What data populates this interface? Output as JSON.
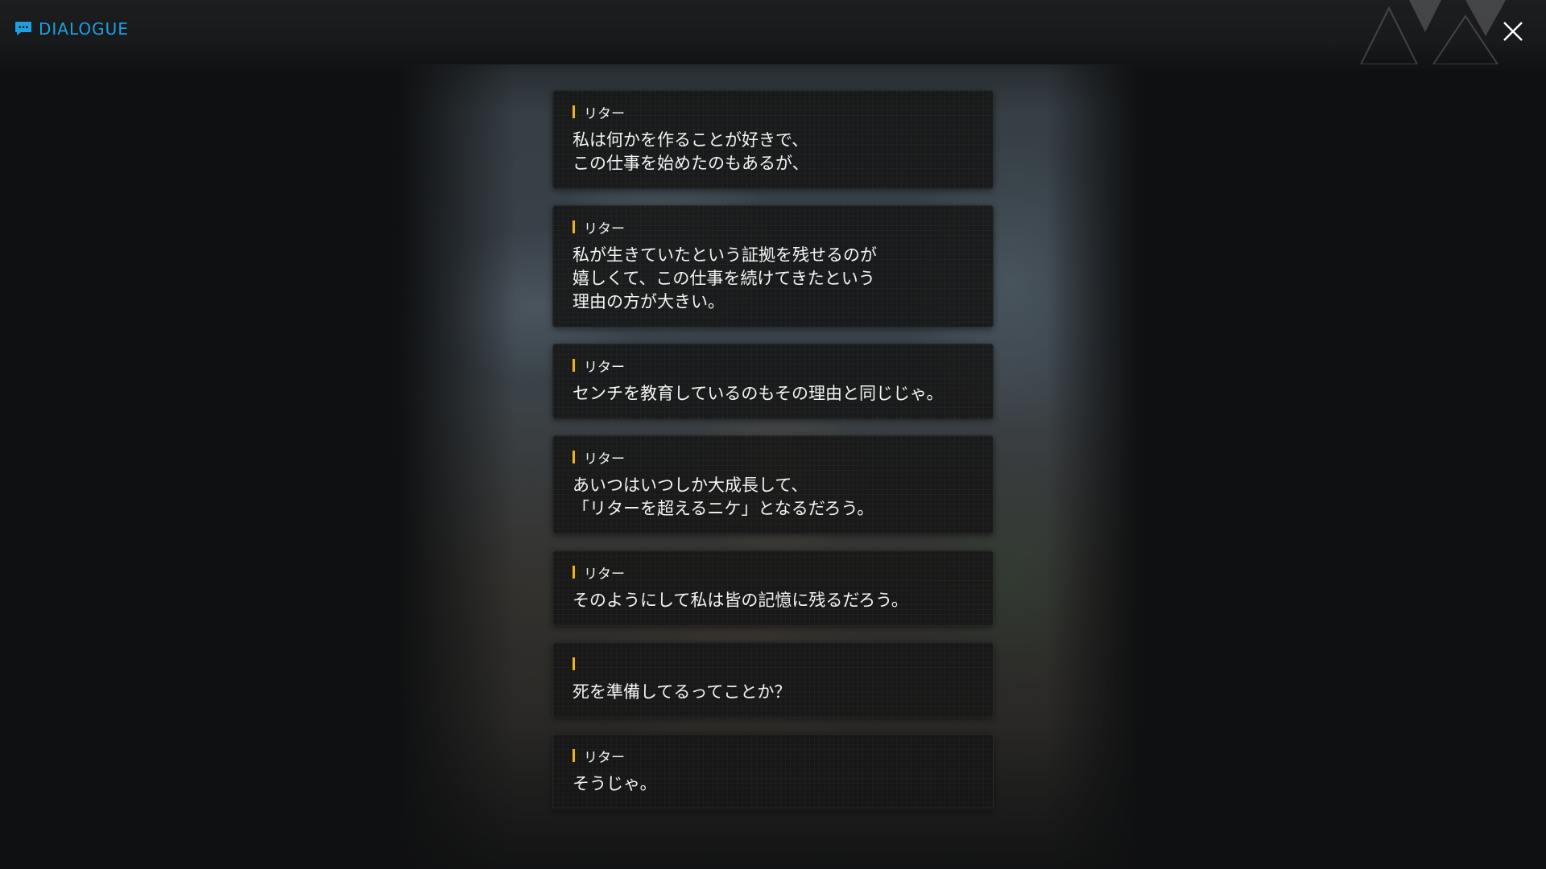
{
  "header": {
    "title": "DIALOGUE",
    "title_icon": "chat-bubble-icon",
    "accent_color": "#1ea0e0",
    "close_icon": "close-icon"
  },
  "dialogue": [
    {
      "speaker": "リター",
      "text": "私は何かを作ることが好きで、\nこの仕事を始めたのもあるが、"
    },
    {
      "speaker": "リター",
      "text": "私が生きていたという証拠を残せるのが\n嬉しくて、この仕事を続けてきたという\n理由の方が大きい。"
    },
    {
      "speaker": "リター",
      "text": "センチを教育しているのもその理由と同じじゃ。"
    },
    {
      "speaker": "リター",
      "text": "あいつはいつしか大成長して、\n「リターを超えるニケ」となるだろう。"
    },
    {
      "speaker": "リター",
      "text": "そのようにして私は皆の記憶に残るだろう。"
    },
    {
      "speaker": "",
      "text": "死を準備してるってことか？"
    },
    {
      "speaker": "リター",
      "text": "そうじゃ。"
    }
  ],
  "colors": {
    "speaker_marker": "#f0b21a",
    "background": "#0f1011",
    "text": "#f4f4f4"
  }
}
